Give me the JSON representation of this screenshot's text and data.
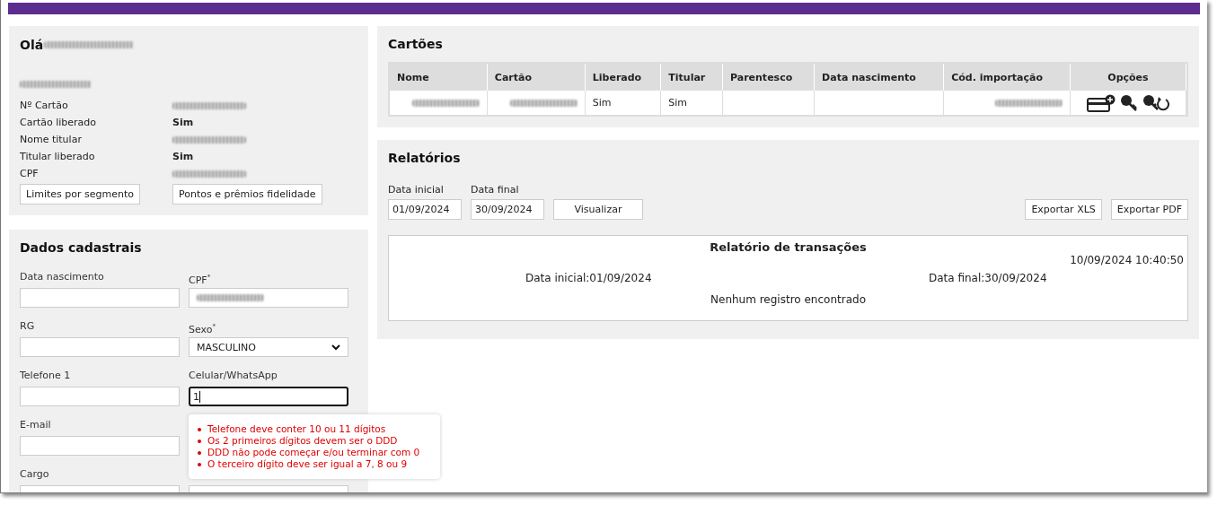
{
  "profile": {
    "greeting": "Olá",
    "rows": [
      {
        "label": "Nº Cartão",
        "kind": "redacted"
      },
      {
        "label": "Cartão liberado",
        "kind": "text",
        "value": "Sim"
      },
      {
        "label": "Nome titular",
        "kind": "redacted"
      },
      {
        "label": "Titular liberado",
        "kind": "text",
        "value": "Sim"
      },
      {
        "label": "CPF",
        "kind": "redacted"
      }
    ],
    "buttons": [
      "Limites por segmento",
      "Pontos e prêmios fidelidade"
    ]
  },
  "form": {
    "title": "Dados cadastrais",
    "fields": [
      {
        "label": "Data nascimento",
        "kind": "text",
        "focused": false
      },
      {
        "label": "CPF$^{*}$",
        "kind": "redacted"
      },
      {
        "label": "RG",
        "kind": "text",
        "focused": false
      },
      {
        "label": "Sexo$^{*}$",
        "kind": "select",
        "value": "MASCULINO"
      },
      {
        "label": "Telefone 1",
        "kind": "text",
        "focused": false
      },
      {
        "label": "Celular/WhatsApp",
        "kind": "text",
        "value": "1",
        "focused": true
      },
      {
        "label": "E-mail",
        "kind": "text",
        "focused": false
      },
      {
        "kind": "hidden"
      },
      {
        "label": "Cargo",
        "kind": "text",
        "focused": false
      },
      {
        "kind": "text",
        "focused": false
      }
    ],
    "errors": [
      "Telefone deve conter 10 ou 11 dígitos",
      "Os 2 primeiros dígitos devem ser o DDD",
      "DDD não pode começar e/ou terminar com 0",
      "O terceiro dígito deve ser igual a 7, 8 ou 9"
    ]
  },
  "cards": {
    "title": "Cartões",
    "columns": [
      "Nome",
      "Cartão",
      "Liberado",
      "Titular",
      "Parentesco",
      "Data nascimento",
      "Cód. importação",
      "Opções"
    ],
    "rows": [
      [
        {
          "kind": "redacted"
        },
        {
          "kind": "redacted"
        },
        {
          "kind": "text",
          "value": "Sim"
        },
        {
          "kind": "text",
          "value": "Sim"
        },
        {
          "kind": "empty"
        },
        {
          "kind": "empty"
        },
        {
          "kind": "redacted"
        },
        {
          "kind": "options"
        }
      ]
    ]
  },
  "reports": {
    "title": "Relatórios",
    "start": {
      "label": "Data inicial",
      "value": "01/09/2024"
    },
    "end": {
      "label": "Data final",
      "value": "30/09/2024"
    },
    "view_button": "Visualizar",
    "export_buttons": [
      "Exportar XLS",
      "Exportar PDF"
    ],
    "report": {
      "title": "Relatório de transações",
      "timestamp": "10/09/2024 10:40:50",
      "start": "Data inicial:01/09/2024",
      "end": "Data final:30/09/2024",
      "empty": "Nenhum registro encontrado"
    }
  }
}
